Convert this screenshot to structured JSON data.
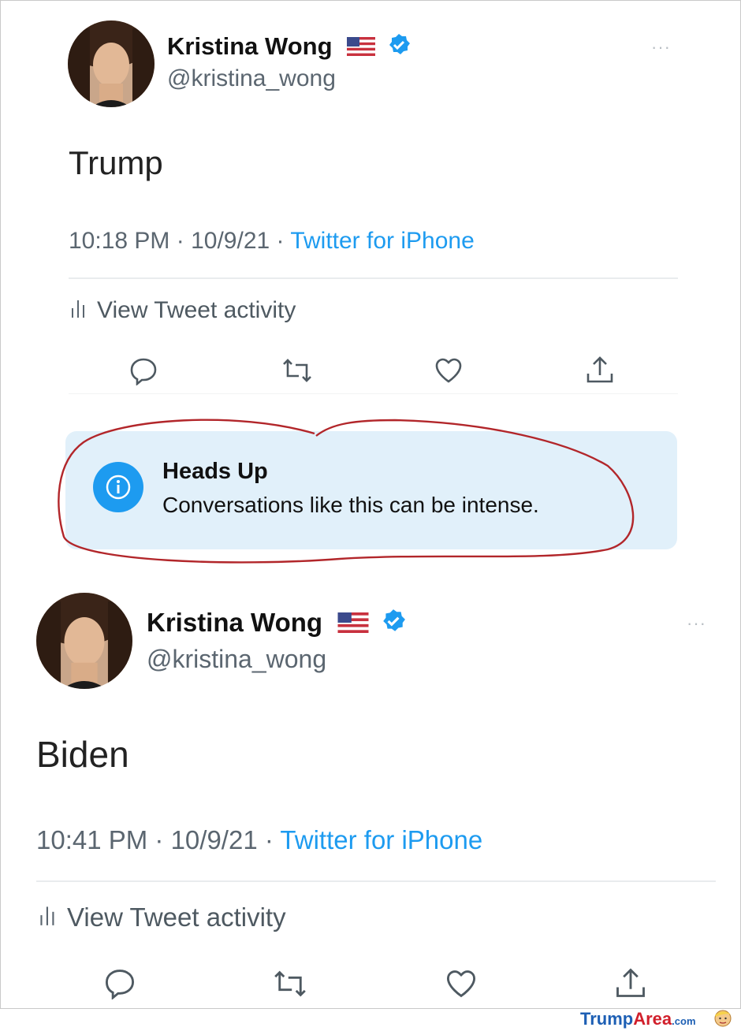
{
  "tweets": [
    {
      "author_name": "Kristina Wong",
      "author_handle": "@kristina_wong",
      "text": "Trump",
      "time": "10:18 PM",
      "date": "10/9/21",
      "source": "Twitter for iPhone",
      "activity_label": "View Tweet activity"
    },
    {
      "author_name": "Kristina Wong",
      "author_handle": "@kristina_wong",
      "text": "Biden",
      "time": "10:41 PM",
      "date": "10/9/21",
      "source": "Twitter for iPhone",
      "activity_label": "View Tweet activity"
    }
  ],
  "notice": {
    "title": "Heads Up",
    "message": "Conversations like this can be intense."
  },
  "separator": " · ",
  "more_label": "···",
  "watermark": {
    "brand_part1": "Trump",
    "brand_part2": "Area",
    "suffix": ".com"
  },
  "colors": {
    "twitter_blue": "#1d9bf0",
    "notice_bg": "#e1f0fa",
    "annotation_red": "#b2262a",
    "watermark_blue": "#1d5fb4",
    "watermark_red": "#d11f2b"
  }
}
